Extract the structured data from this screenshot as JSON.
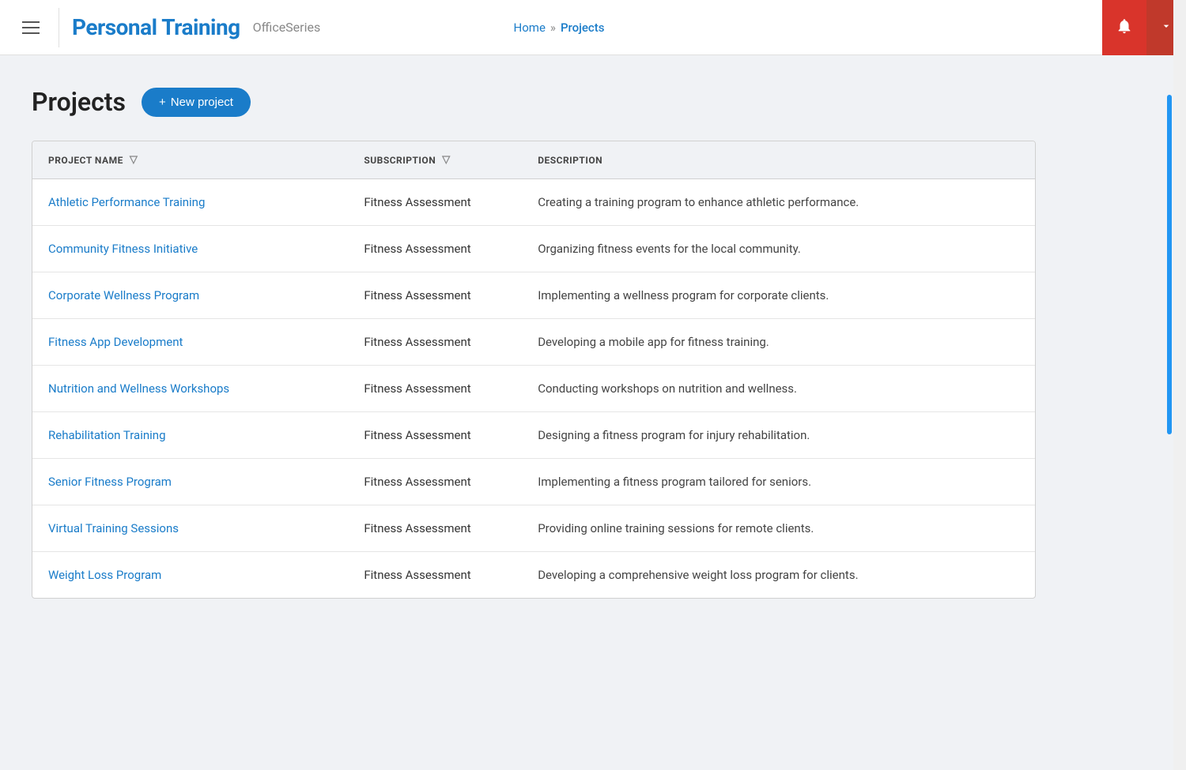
{
  "header": {
    "hamburger_label": "menu",
    "app_title": "Personal Training",
    "app_subtitle": "OfficeSeries",
    "nav": {
      "home": "Home",
      "separator": "»",
      "current": "Projects"
    },
    "bell_label": "notifications",
    "dropdown_label": "user menu"
  },
  "main": {
    "page_title": "Projects",
    "new_project_button": "+ New project",
    "table": {
      "columns": [
        {
          "key": "project_name",
          "label": "PROJECT NAME",
          "has_filter": true
        },
        {
          "key": "subscription",
          "label": "SUBSCRIPTION",
          "has_filter": true
        },
        {
          "key": "description",
          "label": "DESCRIPTION",
          "has_filter": false
        }
      ],
      "rows": [
        {
          "project_name": "Athletic Performance Training",
          "subscription": "Fitness Assessment",
          "description": "Creating a training program to enhance athletic performance."
        },
        {
          "project_name": "Community Fitness Initiative",
          "subscription": "Fitness Assessment",
          "description": "Organizing fitness events for the local community."
        },
        {
          "project_name": "Corporate Wellness Program",
          "subscription": "Fitness Assessment",
          "description": "Implementing a wellness program for corporate clients."
        },
        {
          "project_name": "Fitness App Development",
          "subscription": "Fitness Assessment",
          "description": "Developing a mobile app for fitness training."
        },
        {
          "project_name": "Nutrition and Wellness Workshops",
          "subscription": "Fitness Assessment",
          "description": "Conducting workshops on nutrition and wellness."
        },
        {
          "project_name": "Rehabilitation Training",
          "subscription": "Fitness Assessment",
          "description": "Designing a fitness program for injury rehabilitation."
        },
        {
          "project_name": "Senior Fitness Program",
          "subscription": "Fitness Assessment",
          "description": "Implementing a fitness program tailored for seniors."
        },
        {
          "project_name": "Virtual Training Sessions",
          "subscription": "Fitness Assessment",
          "description": "Providing online training sessions for remote clients."
        },
        {
          "project_name": "Weight Loss Program",
          "subscription": "Fitness Assessment",
          "description": "Developing a comprehensive weight loss program for clients."
        }
      ]
    }
  },
  "colors": {
    "primary_blue": "#1a7cc9",
    "header_red": "#d9342b",
    "accent_blue": "#2196F3"
  }
}
